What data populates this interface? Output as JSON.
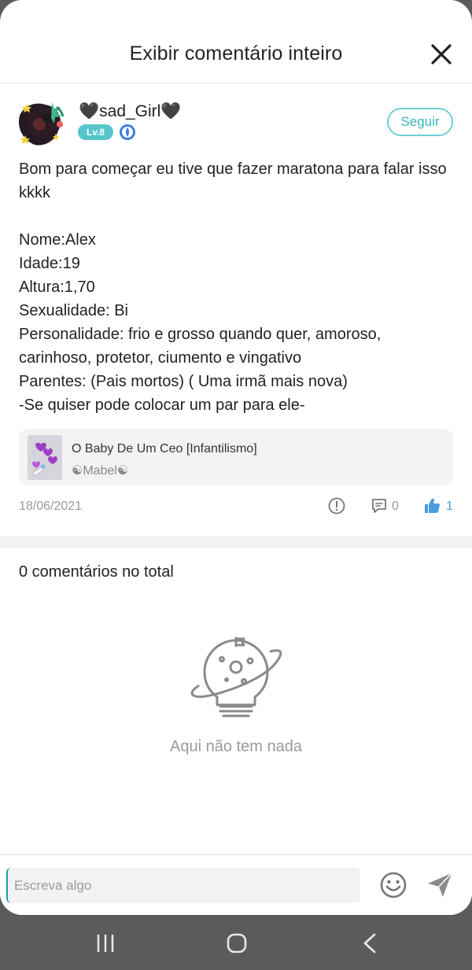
{
  "header": {
    "title": "Exibir comentário inteiro",
    "close_icon": "close-icon"
  },
  "author": {
    "name": "🖤sad_Girl🖤",
    "level": "Lv.8",
    "follow_label": "Seguir"
  },
  "comment": {
    "text": "Bom para começar eu tive que fazer maratona para falar isso kkkk\n\nNome:Alex\nIdade:19\nAltura:1,70\nSexualidade: Bi\nPersonalidade: frio e grosso quando quer, amoroso, carinhoso, protetor, ciumento e vingativo\nParentes: (Pais mortos) ( Uma irmã mais nova)\n-Se quiser pode colocar um par para ele-",
    "linked_post": {
      "title": "O Baby De Um Ceo [Infantilismo]",
      "author": "☯Mabel☯"
    },
    "date": "18/06/2021",
    "comment_count": "0",
    "like_count": "1"
  },
  "comments_section": {
    "total_label": "0 comentários no total",
    "empty_text": "Aqui não tem nada"
  },
  "composer": {
    "placeholder": "Escreva algo"
  },
  "colors": {
    "accent": "#56c6cc",
    "like": "#4a9bdf",
    "muted": "#9a9a9a"
  }
}
